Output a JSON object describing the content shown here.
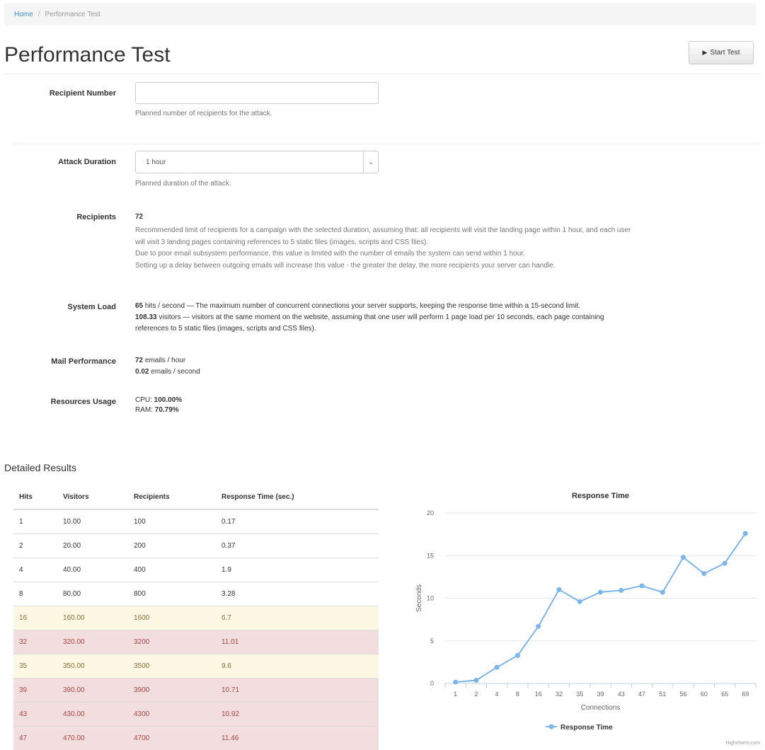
{
  "breadcrumb": {
    "home": "Home",
    "separator": "/",
    "current": "Performance Test"
  },
  "page_title": "Performance Test",
  "start_button": {
    "icon": "play-icon",
    "label": "Start Test"
  },
  "recipient_number": {
    "label": "Recipient Number",
    "value": "",
    "help": "Planned number of recipients for the attack."
  },
  "attack_duration": {
    "label": "Attack Duration",
    "selected": "1 hour",
    "help": "Planned duration of the attack."
  },
  "recipients": {
    "label": "Recipients",
    "value": "72",
    "lines": [
      "Recommended limit of recipients for a campaign with the selected duration, assuming that: all recipients will visit the landing page within 1 hour, and each user",
      "will visit 3 landing pages containing references to 5 static files (images, scripts and CSS files).",
      "Due to poor email subsystem performance, this value is limited with the number of emails the system can send within 1 hour.",
      "Setting up a delay between outgoing emails will increase this value - the greater the delay, the more recipients your server can handle."
    ]
  },
  "system_load": {
    "label": "System Load",
    "hits_value": "65",
    "hits_text": " hits / second — The maximum number of concurrent connections your server supports, keeping the response time within a 15-second limit.",
    "visitors_value": "108.33",
    "visitors_text_1": " visitors — visitors at the same moment on the website, assuming that one user will perform 1 page load per 10 seconds, each page containing",
    "visitors_text_2": "references to 5 static files (images, scripts and CSS files)."
  },
  "mail_performance": {
    "label": "Mail Performance",
    "per_hour_value": "72",
    "per_hour_unit": " emails / hour",
    "per_second_value": "0.02",
    "per_second_unit": " emails / second"
  },
  "resources_usage": {
    "label": "Resources Usage",
    "cpu_label": "CPU: ",
    "cpu_value": "100.00%",
    "ram_label": "RAM: ",
    "ram_value": "70.79%"
  },
  "detailed_results": {
    "title": "Detailed Results",
    "columns": [
      "Hits",
      "Visitors",
      "Recipients",
      "Response Time (sec.)"
    ],
    "rows": [
      {
        "cells": [
          "1",
          "10.00",
          "100",
          "0.17"
        ],
        "status": ""
      },
      {
        "cells": [
          "2",
          "20.00",
          "200",
          "0.37"
        ],
        "status": ""
      },
      {
        "cells": [
          "4",
          "40.00",
          "400",
          "1.9"
        ],
        "status": ""
      },
      {
        "cells": [
          "8",
          "80.00",
          "800",
          "3.28"
        ],
        "status": ""
      },
      {
        "cells": [
          "16",
          "160.00",
          "1600",
          "6.7"
        ],
        "status": "warning"
      },
      {
        "cells": [
          "32",
          "320.00",
          "3200",
          "11.01"
        ],
        "status": "danger"
      },
      {
        "cells": [
          "35",
          "350.00",
          "3500",
          "9.6"
        ],
        "status": "warning"
      },
      {
        "cells": [
          "39",
          "390.00",
          "3900",
          "10.71"
        ],
        "status": "danger"
      },
      {
        "cells": [
          "43",
          "430.00",
          "4300",
          "10.92"
        ],
        "status": "danger"
      },
      {
        "cells": [
          "47",
          "470.00",
          "4700",
          "11.46"
        ],
        "status": "danger"
      }
    ]
  },
  "chart_data": {
    "type": "line",
    "title": "Response Time",
    "xlabel": "Connections",
    "ylabel": "Seconds",
    "categories": [
      "1",
      "2",
      "4",
      "8",
      "16",
      "32",
      "35",
      "39",
      "43",
      "47",
      "51",
      "56",
      "60",
      "65",
      "69"
    ],
    "series": [
      {
        "name": "Response Time",
        "values": [
          0.17,
          0.37,
          1.9,
          3.28,
          6.7,
          11.01,
          9.6,
          10.71,
          10.92,
          11.46,
          10.7,
          14.8,
          12.9,
          14.1,
          17.6
        ]
      }
    ],
    "yticks": [
      0,
      5,
      10,
      15,
      20
    ],
    "ylim": [
      0,
      20
    ],
    "grid": true,
    "legend": "bottom-center",
    "credits": "Highcharts.com",
    "color": "#7cb5ec"
  }
}
